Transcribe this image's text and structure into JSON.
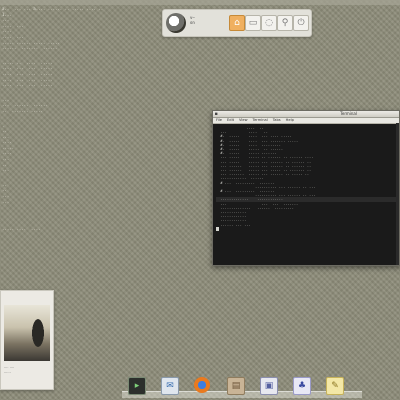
{
  "top_panel": {
    "user_line1": "v—",
    "user_line2": "on",
    "buttons": [
      {
        "name": "home-icon",
        "glyph": "⌂"
      },
      {
        "name": "folder-icon",
        "glyph": "▭"
      },
      {
        "name": "settings-icon",
        "glyph": "◌"
      },
      {
        "name": "search-icon",
        "glyph": "⚲"
      },
      {
        "name": "power-icon",
        "glyph": "⏻"
      }
    ]
  },
  "sysinfo": {
    "header": "a..  ... ... a.... ...... .. ..... .... ..",
    "block1": [
      "1...",
      "...",
      "....  ...",
      "....",
      "....  ...",
      "..... ...... ..... .....",
      "......  .......  ......"
    ],
    "block2": [
      "..... ..  ....  .....",
      "....  ...  ...  .....",
      "....  ...  ...  .....",
      "....  ...  ...  .....",
      "....  ...  ...  ....."
    ],
    "block3": [
      "...",
      "...  ......  ......",
      "..  ....... ....."
    ],
    "block4": [
      ".",
      "..",
      "...",
      "....",
      ".....",
      "....",
      "...",
      "..",
      "..."
    ],
    "block5": [
      "..",
      "..",
      "...",
      "..."
    ],
    "footer": "..... ....  ...."
  },
  "terminal": {
    "title": "Terminal",
    "menu": [
      "File",
      "Edit",
      "View",
      "Terminal",
      "Tabs",
      "Help"
    ],
    "lines": [
      "              ....  ..",
      "  ...          ....   ..",
      "  #.  .....    ....  ... .... .....",
      "  #.  .....    ....  ... ....... .....",
      "  #.  .....    ....  .........",
      "  #.  .....    .....  .. ......",
      "  #.  .....    ..... .......",
      "  ... .....    ..... .. ...... .. ...... ....",
      "  ... .....    ..... ... ...... .. ...... ..",
      "  ... ......   ..... ... ...... .. ...... ..",
      "  ... ......   ..... ... ..... .. ....... ..",
      "  ... .......  ..... ... ...... .. ..... ..",
      "  ............  ......",
      "",
      "  # ...  .........  .......",
      "                  .......... ... ...... .. ...",
      "  # ...  .........  .......",
      "                  .......... ... ...... .. ...",
      "  .............    ............",
      "  ...                ...  ...  .......",
      "  ..............   ......  .........",
      "  ............",
      "  ............",
      "  ............",
      "  ...... ... ..."
    ]
  },
  "preview": {
    "caption_line1": "....  ....",
    "caption_line2": "......"
  },
  "dock": {
    "items": [
      {
        "name": "terminal-dock-icon",
        "glyph": "▸",
        "cls": "term"
      },
      {
        "name": "mail-dock-icon",
        "glyph": "✉",
        "cls": "mail"
      },
      {
        "name": "firefox-dock-icon",
        "glyph": "",
        "cls": "fox"
      },
      {
        "name": "image-viewer-dock-icon",
        "glyph": "▤",
        "cls": "img"
      },
      {
        "name": "screenshot-dock-icon",
        "glyph": "▣",
        "cls": "screen"
      },
      {
        "name": "pidgin-dock-icon",
        "glyph": "♣",
        "cls": "pidgin"
      },
      {
        "name": "notes-dock-icon",
        "glyph": "✎",
        "cls": "note"
      }
    ]
  }
}
